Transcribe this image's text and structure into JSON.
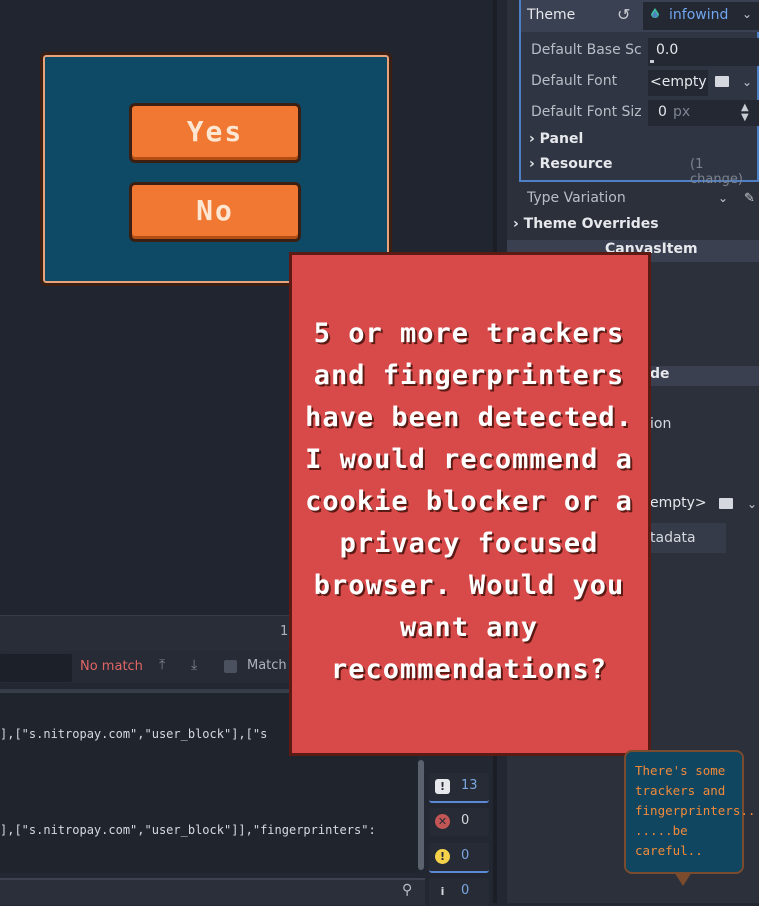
{
  "output": {
    "tab_number": "1",
    "find": {
      "status": "No match",
      "match_case_label": "Match"
    },
    "lines": [
      "],[\"s.nitropay.com\",\"user_block\"],[\"s",
      "],[\"s.nitropay.com\",\"user_block\"]],\"fingerprinters\":"
    ],
    "badges": {
      "messages": "13",
      "errors": "0",
      "warnings": "0",
      "debug": "0"
    }
  },
  "inspector": {
    "theme_label": "Theme",
    "theme_value": "infowind",
    "props": {
      "default_base_scale_label": "Default Base Sc",
      "default_base_scale_value": "0.0",
      "default_font_label": "Default Font",
      "default_font_value": "<empty",
      "default_font_size_label": "Default Font Siz",
      "default_font_size_value": "0",
      "default_font_size_unit": "px"
    },
    "sections": {
      "panel": "Panel",
      "resource": "Resource",
      "resource_changes": "(1 change)"
    },
    "type_variation_label": "Type Variation",
    "theme_overrides": "Theme Overrides",
    "canvas_item": "CanvasItem",
    "partial": {
      "de": "de",
      "ion": "ion",
      "empty": "empty>",
      "metadata": "tadata"
    }
  },
  "dialog": {
    "yes": "Yes",
    "no": "No"
  },
  "popup": {
    "message": "5 or more trackers and fingerprinters have been detected. I would recommend a cookie blocker or a privacy focused browser. Would you want any recommendations?"
  },
  "tooltip": {
    "text": "There's some\ntrackers and\nfingerprinters..\n.....be\ncareful.."
  },
  "colors": {
    "editor_bg": "#222731",
    "accent_blue": "#4f7fc4",
    "dialog_bg": "#0e4a66",
    "button_orange": "#f07832",
    "popup_red": "#d84a4a",
    "tooltip_text": "#f08a3a",
    "error_red": "#e26565"
  }
}
